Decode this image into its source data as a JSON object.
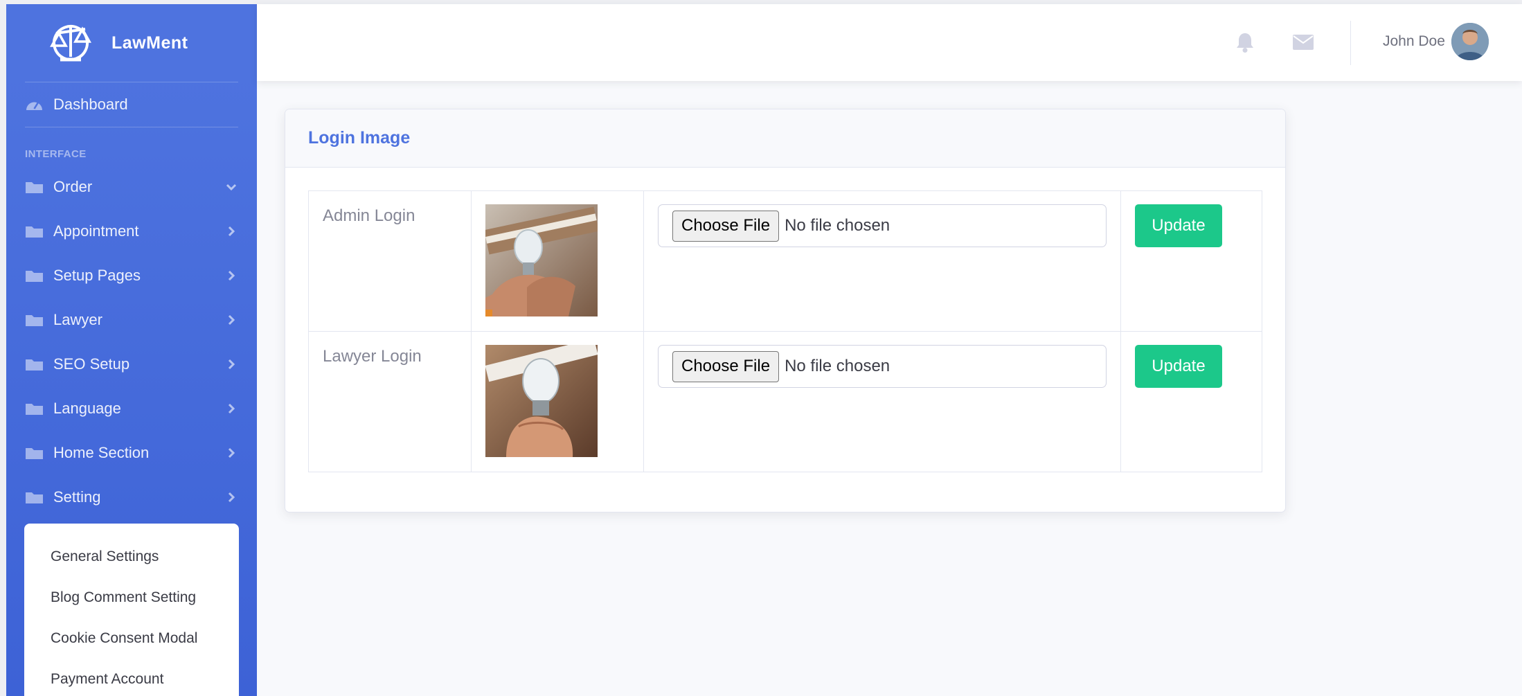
{
  "brand": {
    "name": "LawMent"
  },
  "sidebar": {
    "dashboard": "Dashboard",
    "heading": "INTERFACE",
    "items": [
      {
        "label": "Order",
        "expanded": true
      },
      {
        "label": "Appointment"
      },
      {
        "label": "Setup Pages"
      },
      {
        "label": "Lawyer"
      },
      {
        "label": "SEO Setup"
      },
      {
        "label": "Language"
      },
      {
        "label": "Home Section"
      },
      {
        "label": "Setting"
      }
    ],
    "submenu": [
      "General Settings",
      "Blog Comment Setting",
      "Cookie Consent Modal",
      "Payment Account"
    ]
  },
  "topbar": {
    "user_name": "John Doe",
    "icons": [
      "bell-icon",
      "envelope-icon"
    ]
  },
  "card": {
    "title": "Login Image",
    "rows": [
      {
        "label": "Admin Login",
        "choose_label": "Choose File",
        "file_status": "No file chosen",
        "update_label": "Update"
      },
      {
        "label": "Lawyer Login",
        "choose_label": "Choose File",
        "file_status": "No file chosen",
        "update_label": "Update"
      }
    ]
  },
  "colors": {
    "sidebar": "#4e73df",
    "primary": "#4e73df",
    "success": "#1cc88a",
    "background": "#f8f9fc"
  }
}
